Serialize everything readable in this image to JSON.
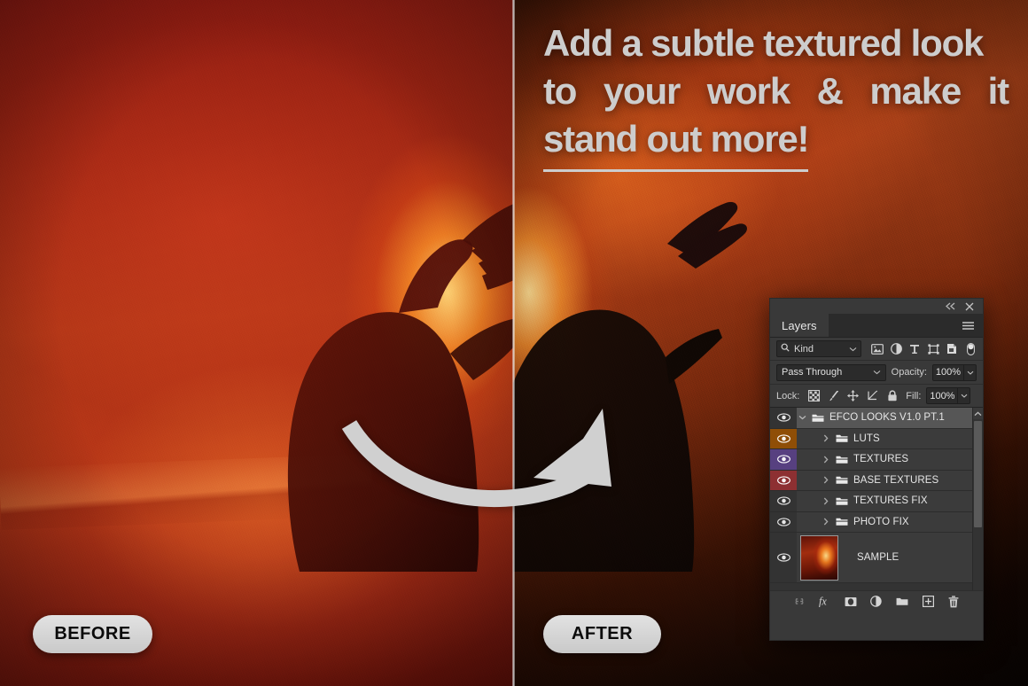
{
  "headline": {
    "line1": "Add a subtle textured look",
    "line2_words": [
      "to",
      "your",
      "work",
      "&",
      "make",
      "it"
    ],
    "line3": "stand out more!",
    "color": "#cdcdcd"
  },
  "badges": {
    "before": "BEFORE",
    "after": "AFTER"
  },
  "panel": {
    "titlebar": {
      "collapse_icon": "double-chevron-left-icon",
      "close_icon": "close-icon"
    },
    "tab_label": "Layers",
    "menu_icon": "hamburger-menu-icon",
    "filter": {
      "search_icon": "search-icon",
      "kind_label": "Kind",
      "chevron": "chevron-down-icon",
      "icons": [
        "pixel-layer-filter-icon",
        "adjustment-layer-filter-icon",
        "type-layer-filter-icon",
        "shape-layer-filter-icon",
        "smart-object-filter-icon",
        "filter-toggle-switch"
      ]
    },
    "blend": {
      "mode": "Pass Through",
      "opacity_label": "Opacity:",
      "opacity_value": "100%"
    },
    "lock": {
      "label": "Lock:",
      "icons": [
        "lock-transparency-icon",
        "lock-image-brush-icon",
        "lock-position-move-icon",
        "lock-artboard-icon",
        "lock-all-padlock-icon"
      ],
      "fill_label": "Fill:",
      "fill_value": "100%"
    },
    "layers": [
      {
        "name": "EFCO LOOKS V1.0 PT.1",
        "type": "group",
        "expanded": true,
        "selected": true,
        "depth": 0,
        "color": "none",
        "visible": true
      },
      {
        "name": "LUTS",
        "type": "group",
        "expanded": false,
        "selected": false,
        "depth": 1,
        "color": "#8f4e06",
        "visible": true
      },
      {
        "name": "TEXTURES",
        "type": "group",
        "expanded": false,
        "selected": false,
        "depth": 1,
        "color": "#574080",
        "visible": true
      },
      {
        "name": "BASE TEXTURES",
        "type": "group",
        "expanded": false,
        "selected": false,
        "depth": 1,
        "color": "#8d3032",
        "visible": true
      },
      {
        "name": "TEXTURES FIX",
        "type": "group",
        "expanded": false,
        "selected": false,
        "depth": 1,
        "color": "none",
        "visible": true
      },
      {
        "name": "PHOTO FIX",
        "type": "group",
        "expanded": false,
        "selected": false,
        "depth": 1,
        "color": "none",
        "visible": true
      },
      {
        "name": "SAMPLE",
        "type": "image",
        "expanded": false,
        "selected": false,
        "depth": 0,
        "color": "none",
        "visible": true
      }
    ],
    "footer_icons": [
      "link-layers-icon",
      "layer-style-fx-icon",
      "add-layer-mask-icon",
      "new-adjustment-layer-icon",
      "new-group-folder-icon",
      "new-layer-icon",
      "delete-layer-trash-icon"
    ],
    "scrollbar": {
      "up_arrow_icon": "chevron-up-icon"
    }
  },
  "arrow": {
    "name": "curved-arrow-pointing-right"
  }
}
